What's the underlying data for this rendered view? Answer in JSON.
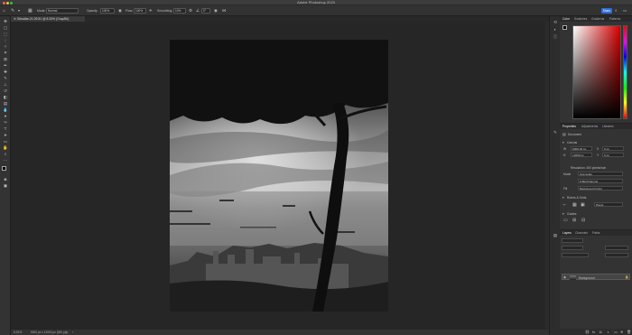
{
  "app": {
    "title": "Adobe Photoshop 2023"
  },
  "options_bar": {
    "mode_label": "Mode:",
    "mode_value": "Normal",
    "opacity_label": "Opacity:",
    "opacity_value": "100%",
    "flow_label": "Flow:",
    "flow_value": "100%",
    "smoothing_label": "Smoothing:",
    "smoothing_value": "10%",
    "angle_value": "0°",
    "share_label": "Share"
  },
  "document": {
    "tab_label": "Gibraltar-21.09.81 @ 8.33% (Gray/8#)",
    "zoom": "8.33%",
    "dimensions": "9000 px x 12000 px (300 ppi)"
  },
  "colors": {
    "share": "#2f6fd8",
    "accent_red": "#d40000"
  },
  "color_panel": {
    "tabs": [
      "Color",
      "Swatches",
      "Gradients",
      "Patterns"
    ]
  },
  "properties_panel": {
    "tabs": [
      "Properties",
      "Adjustments",
      "Libraries"
    ],
    "doc_label": "Document",
    "canvas_heading": "Canvas",
    "width": "9000.00 px",
    "height": "12000 px",
    "x": "0 px",
    "y": "0 px",
    "resolution": "Resolution: 300 pixels/inch",
    "mode_label": "Mode",
    "mode_value": "Grayscale",
    "depth_value": "8 Bits/Channel",
    "fill_label": "Fill",
    "background_label": "Background Color",
    "rulers_heading": "Rulers & Grids",
    "rulers_unit": "Pixels",
    "guides_heading": "Guides"
  },
  "layers_panel": {
    "tabs": [
      "Layers",
      "Channels",
      "Paths"
    ],
    "layer_name": "Background"
  }
}
